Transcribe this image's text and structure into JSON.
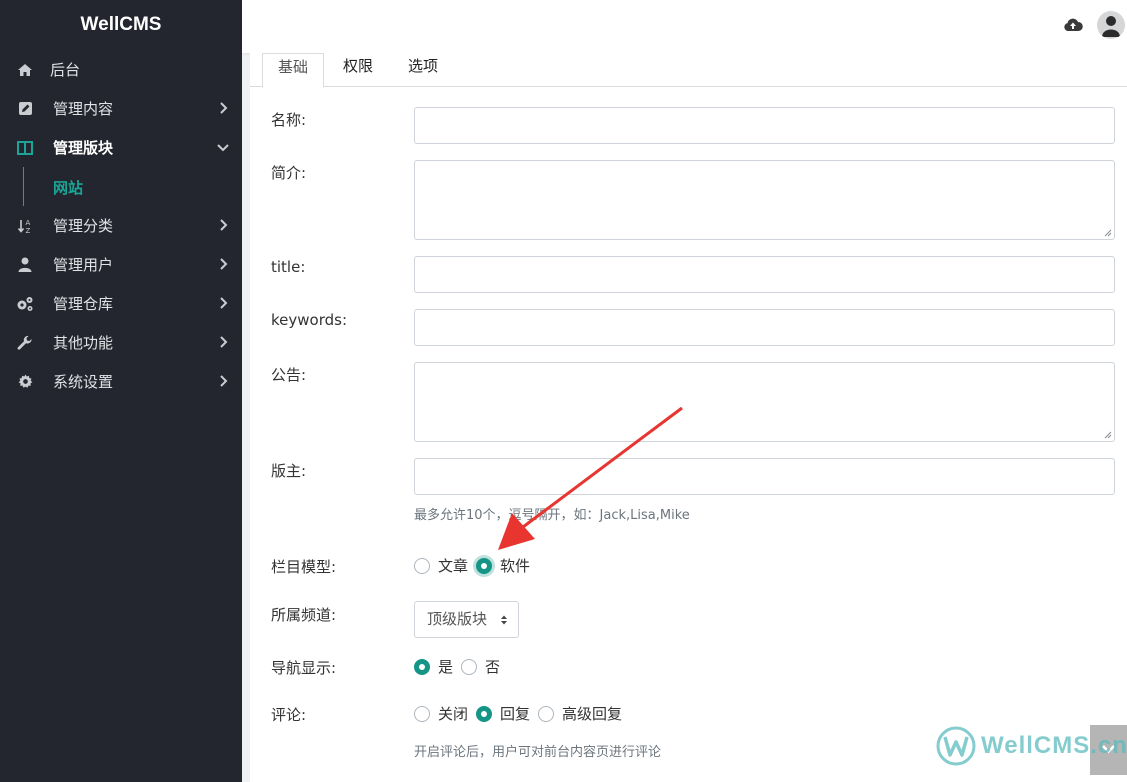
{
  "sidebar": {
    "brand": "WellCMS",
    "items": [
      {
        "label": "后台",
        "icon": "home-icon"
      },
      {
        "label": "管理内容",
        "icon": "edit-icon"
      },
      {
        "label": "管理版块",
        "icon": "columns-icon"
      },
      {
        "label": "管理分类",
        "icon": "sort-icon"
      },
      {
        "label": "管理用户",
        "icon": "user-icon"
      },
      {
        "label": "管理仓库",
        "icon": "cogs-icon"
      },
      {
        "label": "其他功能",
        "icon": "wrench-icon"
      },
      {
        "label": "系统设置",
        "icon": "gear-icon"
      }
    ],
    "submenu": {
      "label": "网站"
    }
  },
  "tabs": [
    {
      "label": "基础",
      "active": true
    },
    {
      "label": "权限",
      "active": false
    },
    {
      "label": "选项",
      "active": false
    }
  ],
  "form": {
    "name_label": "名称:",
    "name_value": "",
    "intro_label": "简介:",
    "intro_value": "",
    "title_label": "title:",
    "title_value": "",
    "keywords_label": "keywords:",
    "keywords_value": "",
    "notice_label": "公告:",
    "notice_value": "",
    "moderator_label": "版主:",
    "moderator_value": "",
    "moderator_help": "最多允许10个，逗号隔开，如：Jack,Lisa,Mike",
    "model_label": "栏目模型:",
    "model_options": [
      "文章",
      "软件"
    ],
    "model_selected": "软件",
    "channel_label": "所属频道:",
    "channel_value": "顶级版块",
    "nav_label": "导航显示:",
    "nav_options": [
      "是",
      "否"
    ],
    "nav_selected": "是",
    "comment_label": "评论:",
    "comment_options": [
      "关闭",
      "回复",
      "高级回复"
    ],
    "comment_selected": "回复",
    "comment_help": "开启评论后，用户可对前台内容页进行评论"
  },
  "watermark": {
    "text": "WellCMS.cn"
  },
  "colors": {
    "accent": "#159585",
    "sidebar_bg": "#23262e",
    "arrow": "#e8352f"
  }
}
